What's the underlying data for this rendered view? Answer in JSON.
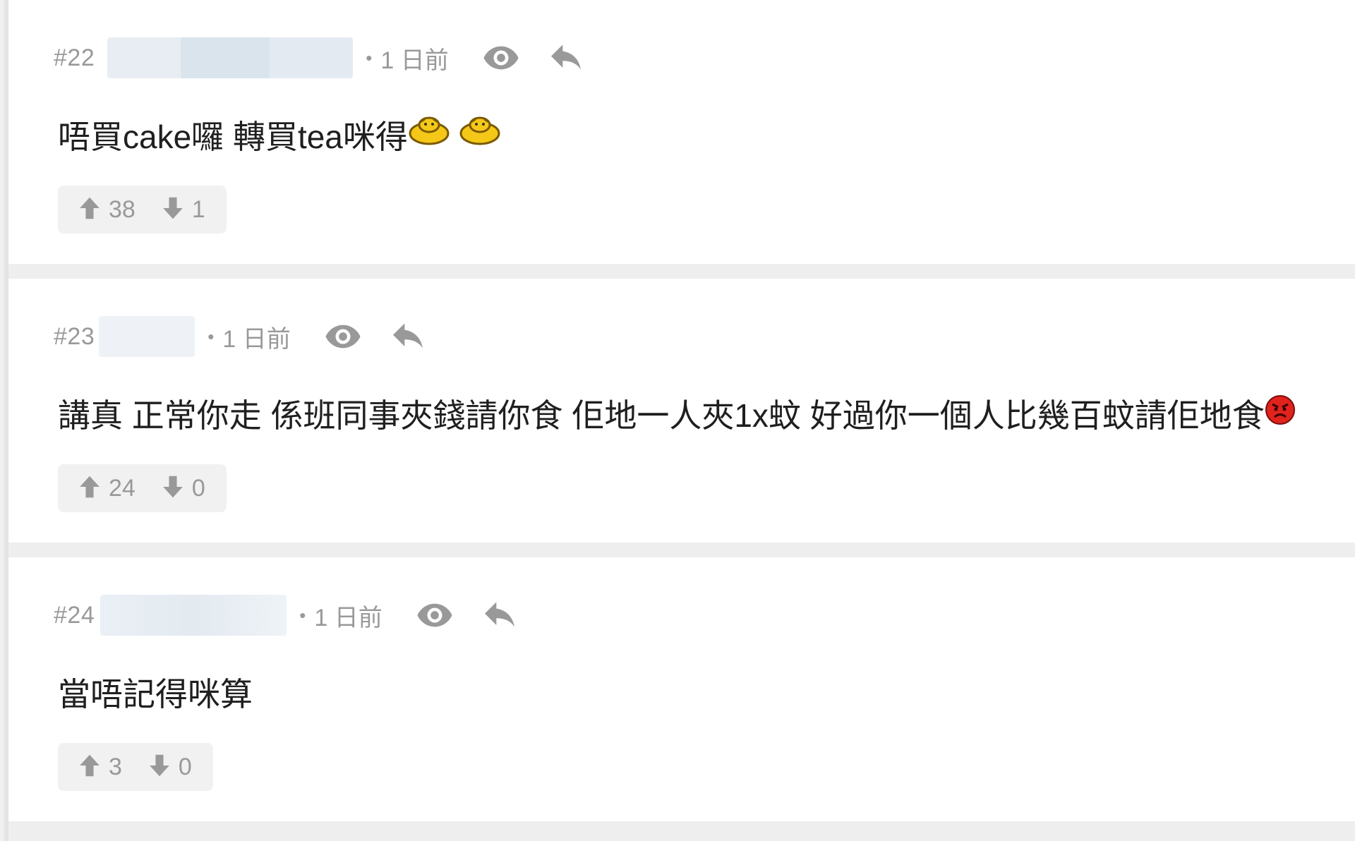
{
  "posts": [
    {
      "number": "#22",
      "time": "1 日前",
      "content": "唔買cake囉 轉買tea咪得",
      "emojis": [
        "duck-icon",
        "duck-icon"
      ],
      "upvotes": "38",
      "downvotes": "1"
    },
    {
      "number": "#23",
      "time": "1 日前",
      "content": "講真 正常你走 係班同事夾錢請你食 佢地一人夾1x蚊 好過你一個人比幾百蚊請佢地食",
      "emojis": [
        "angry-face-icon"
      ],
      "upvotes": "24",
      "downvotes": "0"
    },
    {
      "number": "#24",
      "time": "1 日前",
      "content": "當唔記得咪算",
      "emojis": [],
      "upvotes": "3",
      "downvotes": "0"
    }
  ],
  "meta": {
    "separator": "•"
  },
  "colors": {
    "muted": "#999999",
    "vote_bg": "#f1f1f1",
    "divider": "#eeeeee"
  }
}
